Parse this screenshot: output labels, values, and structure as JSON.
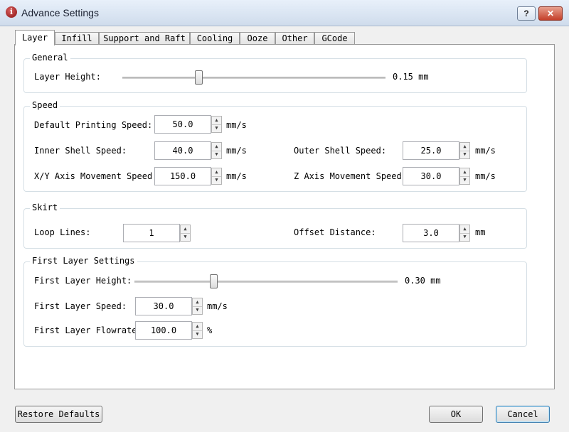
{
  "window": {
    "title": "Advance Settings",
    "help_label": "?",
    "close_label": "✕"
  },
  "tabs": [
    "Layer",
    "Infill",
    "Support and Raft",
    "Cooling",
    "Ooze",
    "Other",
    "GCode"
  ],
  "general": {
    "title": "General",
    "layer_height": {
      "label": "Layer Height:",
      "value": "0.15 mm",
      "slider_fraction": 0.29
    }
  },
  "speed": {
    "title": "Speed",
    "default_printing": {
      "label": "Default Printing Speed:",
      "value": "50.0",
      "unit": "mm/s"
    },
    "inner_shell": {
      "label": "Inner Shell Speed:",
      "value": "40.0",
      "unit": "mm/s"
    },
    "outer_shell": {
      "label": "Outer Shell Speed:",
      "value": "25.0",
      "unit": "mm/s"
    },
    "xy_axis": {
      "label": "X/Y Axis Movement Speed:",
      "value": "150.0",
      "unit": "mm/s"
    },
    "z_axis": {
      "label": "Z Axis Movement Speed:",
      "value": "30.0",
      "unit": "mm/s"
    }
  },
  "skirt": {
    "title": "Skirt",
    "loop_lines": {
      "label": "Loop Lines:",
      "value": "1"
    },
    "offset_distance": {
      "label": "Offset Distance:",
      "value": "3.0",
      "unit": "mm"
    }
  },
  "first_layer": {
    "title": "First Layer Settings",
    "height": {
      "label": "First Layer Height:",
      "value": "0.30 mm",
      "slider_fraction": 0.3
    },
    "speed": {
      "label": "First Layer Speed:",
      "value": "30.0",
      "unit": "mm/s"
    },
    "flowrate": {
      "label": "First Layer Flowrate:",
      "value": "100.0",
      "unit": "%"
    }
  },
  "buttons": {
    "restore": "Restore Defaults",
    "ok": "OK",
    "cancel": "Cancel"
  },
  "colors": {
    "title_bar": "#dbe6f3",
    "close_button": "#c4402a"
  }
}
